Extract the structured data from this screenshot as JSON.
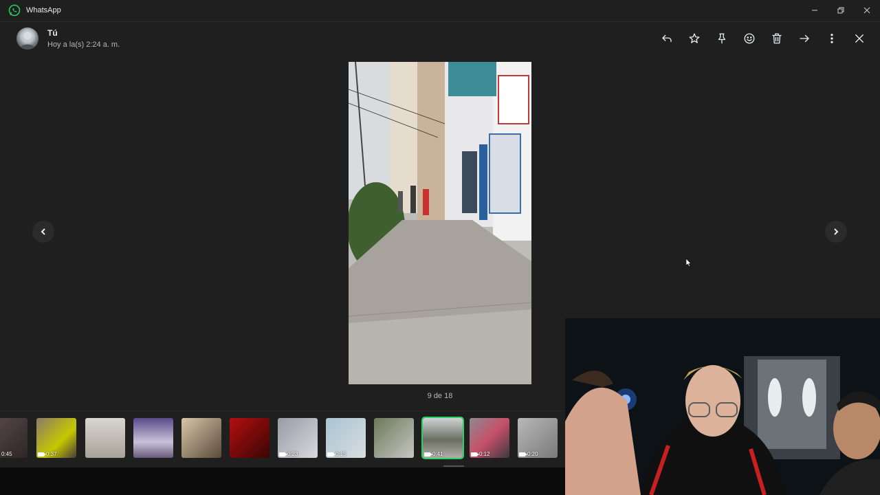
{
  "window": {
    "app_title": "WhatsApp",
    "logo_icon": "whatsapp-logo-icon",
    "controls": [
      "minimize-icon",
      "restore-icon",
      "close-icon"
    ]
  },
  "header": {
    "sender": "Tú",
    "timestamp": "Hoy a la(s) 2:24 a. m.",
    "actions": [
      "reply-icon",
      "star-icon",
      "pin-icon",
      "emoji-icon",
      "delete-icon",
      "forward-icon",
      "more-icon",
      "close-viewer-icon"
    ]
  },
  "viewer": {
    "counter": "9 de 18",
    "prev_icon": "chevron-left-icon",
    "next_icon": "chevron-right-icon"
  },
  "thumbnails": [
    {
      "duration": "0:45",
      "video": true
    },
    {
      "duration": "0:37",
      "video": true
    },
    {
      "duration": "",
      "video": false
    },
    {
      "duration": "",
      "video": false
    },
    {
      "duration": "",
      "video": false
    },
    {
      "duration": "",
      "video": false
    },
    {
      "duration": "0:23",
      "video": true
    },
    {
      "duration": "0:15",
      "video": true
    },
    {
      "duration": "",
      "video": false
    },
    {
      "duration": "0:41",
      "video": true,
      "selected": true
    },
    {
      "duration": "0:12",
      "video": true
    },
    {
      "duration": "0:20",
      "video": true
    }
  ],
  "colors": {
    "background": "#1f1f1f",
    "accent": "#25d366",
    "text": "#e9edef",
    "muted": "#aebac1"
  }
}
